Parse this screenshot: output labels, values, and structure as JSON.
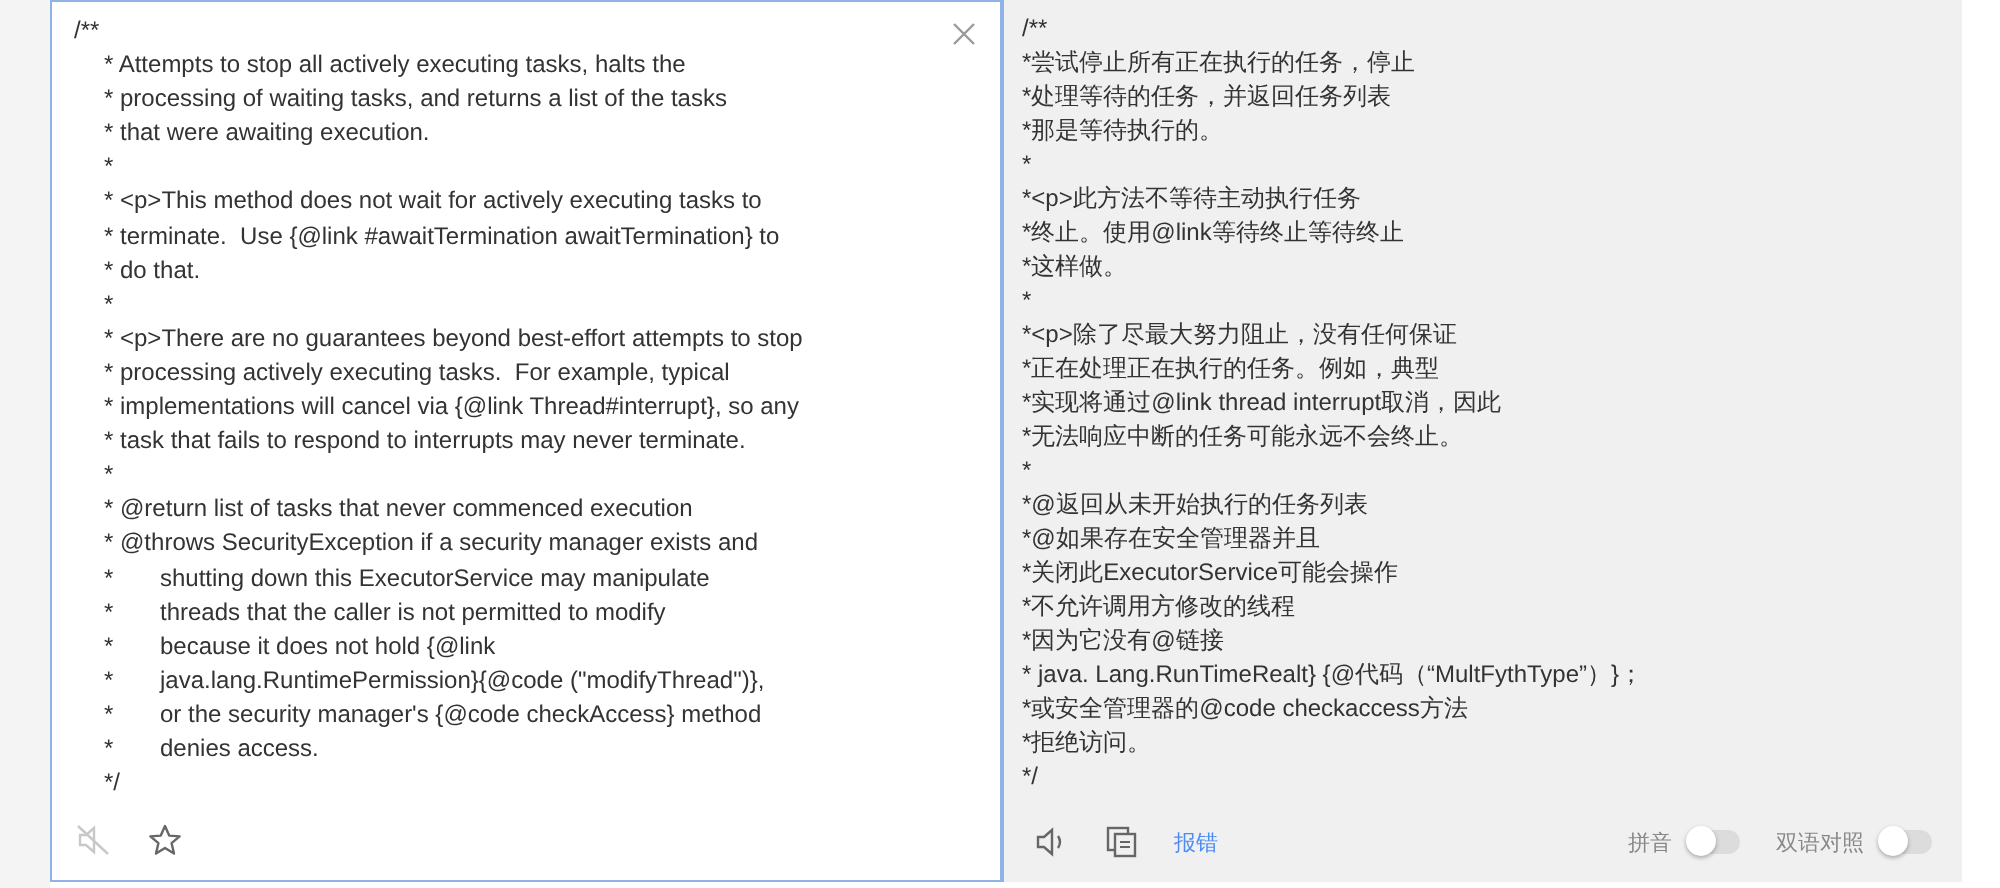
{
  "source": {
    "lines": [
      {
        "kind": "open",
        "text": "/**"
      },
      {
        "kind": "body",
        "text": "* Attempts to stop all actively executing tasks, halts the"
      },
      {
        "kind": "body",
        "text": "* processing of waiting tasks, and returns a list of the tasks"
      },
      {
        "kind": "body",
        "text": "* that were awaiting execution."
      },
      {
        "kind": "body",
        "text": "*"
      },
      {
        "kind": "body",
        "text": "* <p>This method does not wait for actively executing tasks to"
      },
      {
        "kind": "body",
        "text": "* terminate.  Use {@link #awaitTermination awaitTermination} to"
      },
      {
        "kind": "body",
        "text": "* do that."
      },
      {
        "kind": "body",
        "text": "*"
      },
      {
        "kind": "body",
        "text": "* <p>There are no guarantees beyond best-effort attempts to stop"
      },
      {
        "kind": "body",
        "text": "* processing actively executing tasks.  For example, typical"
      },
      {
        "kind": "body",
        "text": "* implementations will cancel via {@link Thread#interrupt}, so any"
      },
      {
        "kind": "body",
        "text": "* task that fails to respond to interrupts may never terminate."
      },
      {
        "kind": "body",
        "text": "*"
      },
      {
        "kind": "body",
        "text": "* @return list of tasks that never commenced execution"
      },
      {
        "kind": "body",
        "text": "* @throws SecurityException if a security manager exists and"
      },
      {
        "kind": "cont",
        "mark": "*",
        "text": "shutting down this ExecutorService may manipulate"
      },
      {
        "kind": "cont",
        "mark": "*",
        "text": "threads that the caller is not permitted to modify"
      },
      {
        "kind": "cont",
        "mark": "*",
        "text": "because it does not hold {@link"
      },
      {
        "kind": "cont",
        "mark": "*",
        "text": "java.lang.RuntimePermission}{@code (\"modifyThread\")},"
      },
      {
        "kind": "cont",
        "mark": "*",
        "text": "or the security manager's {@code checkAccess} method"
      },
      {
        "kind": "cont",
        "mark": "*",
        "text": "denies access."
      },
      {
        "kind": "body",
        "text": "*/"
      }
    ],
    "muted": true
  },
  "translation": {
    "lines": [
      "/**",
      "*尝试停止所有正在执行的任务，停止",
      "*处理等待的任务，并返回任务列表",
      "*那是等待执行的。",
      "*",
      "*<p>此方法不等待主动执行任务",
      "*终止。使用@link等待终止等待终止",
      "*这样做。",
      "*",
      "*<p>除了尽最大努力阻止，没有任何保证",
      "*正在处理正在执行的任务。例如，典型",
      "*实现将通过@link thread interrupt取消，因此",
      "*无法响应中断的任务可能永远不会终止。",
      "*",
      "*@返回从未开始执行的任务列表",
      "*@如果存在安全管理器并且",
      "*关闭此ExecutorService可能会操作",
      "*不允许调用方修改的线程",
      "*因为它没有@链接",
      "* java. Lang.RunTimeRealt} {@代码（“MultFythType”）}；",
      "*或安全管理器的@code checkaccess方法",
      "*拒绝访问。",
      "*/"
    ],
    "report_link": "报错",
    "toggles": [
      {
        "label": "拼音",
        "on": false
      },
      {
        "label": "双语对照",
        "on": false
      }
    ]
  }
}
